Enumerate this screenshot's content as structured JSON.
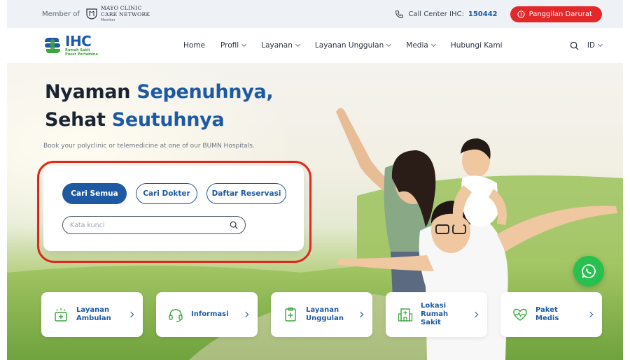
{
  "topbar": {
    "member_label": "Member of",
    "partner_line1": "MAYO CLINIC",
    "partner_line2": "CARE NETWORK",
    "partner_line3": "Member",
    "call_center_label": "Call Center IHC:",
    "call_center_number": "150442",
    "emergency_label": "Panggilan Darurat"
  },
  "brand": {
    "logo_text": "IHC",
    "logo_sub1": "Rumah Sakit",
    "logo_sub2": "Pusat Pertamina",
    "primary_color": "#1d5aa3",
    "accent_green": "#39a53c",
    "emergency_color": "#e3282a"
  },
  "nav": {
    "items": [
      {
        "label": "Home",
        "dropdown": false
      },
      {
        "label": "Profil",
        "dropdown": true
      },
      {
        "label": "Layanan",
        "dropdown": true
      },
      {
        "label": "Layanan Unggulan",
        "dropdown": true
      },
      {
        "label": "Media",
        "dropdown": true
      },
      {
        "label": "Hubungi Kami",
        "dropdown": false
      }
    ],
    "language": "ID"
  },
  "hero": {
    "title_line1_dark": "Nyaman",
    "title_line1_blue": "Sepenuhnya,",
    "title_line2_dark": "Sehat",
    "title_line2_blue": "Seutuhnya",
    "subtitle": "Book your polyclinic or telemedicine at one of our BUMN Hospitals."
  },
  "search": {
    "tabs": [
      {
        "label": "Cari Semua",
        "active": true
      },
      {
        "label": "Cari Dokter",
        "active": false
      },
      {
        "label": "Daftar Reservasi",
        "active": false
      }
    ],
    "placeholder": "Kata kunci"
  },
  "services": [
    {
      "label_line1": "Layanan",
      "label_line2": "Ambulan",
      "icon": "ambulance-icon"
    },
    {
      "label_line1": "Informasi",
      "label_line2": "",
      "icon": "headset-icon"
    },
    {
      "label_line1": "Layanan",
      "label_line2": "Unggulan",
      "icon": "clipboard-medical-icon"
    },
    {
      "label_line1": "Lokasi",
      "label_line2": "Rumah Sakit",
      "icon": "hospital-icon"
    },
    {
      "label_line1": "Paket",
      "label_line2": "Medis",
      "icon": "heart-pulse-icon"
    }
  ]
}
